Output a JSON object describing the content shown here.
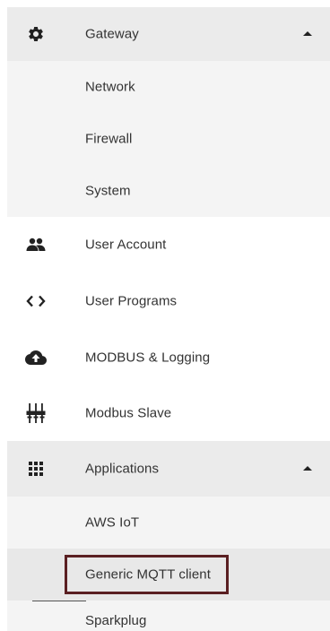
{
  "menu": {
    "gateway": {
      "label": "Gateway",
      "icon": "gear-icon",
      "expanded": true,
      "children": [
        {
          "label": "Network"
        },
        {
          "label": "Firewall"
        },
        {
          "label": "System"
        }
      ]
    },
    "user_account": {
      "label": "User Account",
      "icon": "users-icon"
    },
    "user_programs": {
      "label": "User Programs",
      "icon": "code-icon"
    },
    "modbus_logging": {
      "label": "MODBUS & Logging",
      "icon": "cloud-upload-icon"
    },
    "modbus_slave": {
      "label": "Modbus Slave",
      "icon": "connector-icon"
    },
    "applications": {
      "label": "Applications",
      "icon": "apps-grid-icon",
      "expanded": true,
      "children": [
        {
          "label": "AWS IoT"
        },
        {
          "label": "Generic MQTT client",
          "selected": true
        },
        {
          "label": "Sparkplug"
        }
      ]
    }
  },
  "colors": {
    "expanded_parent_bg": "#ebebeb",
    "child_bg": "#f4f4f4",
    "selection_outline": "#5a1f22",
    "text": "#333333"
  }
}
